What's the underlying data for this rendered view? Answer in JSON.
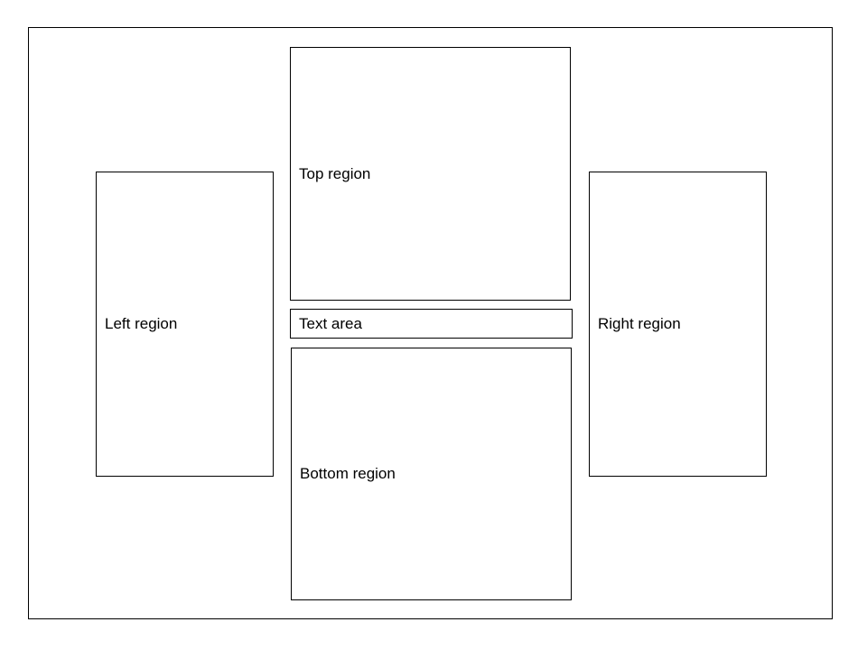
{
  "regions": {
    "left": "Left region",
    "top": "Top region",
    "text_area": "Text area",
    "bottom": "Bottom region",
    "right": "Right region"
  }
}
